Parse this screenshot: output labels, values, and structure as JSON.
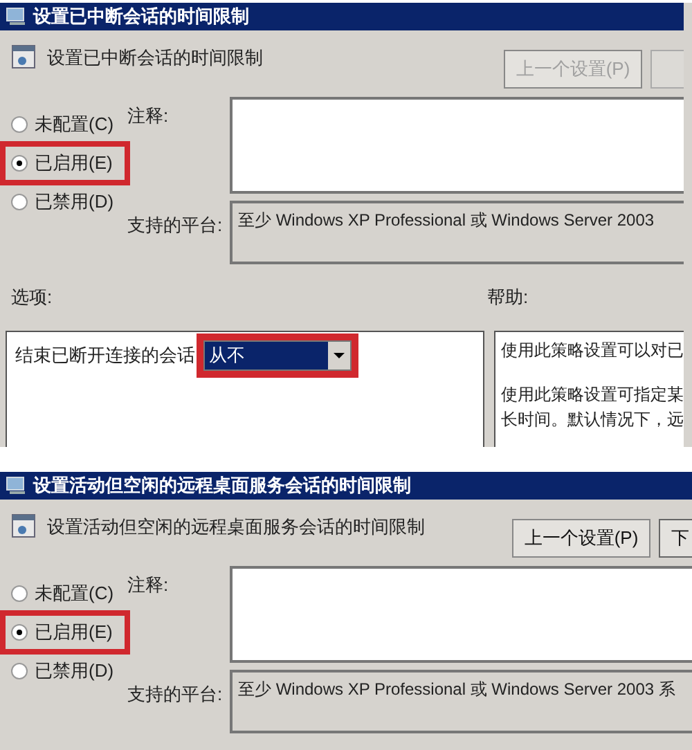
{
  "dialogs": [
    {
      "title": "设置已中断会话的时间限制",
      "heading": "设置已中断会话的时间限制",
      "prev_button": {
        "label": "上一个设置(P)",
        "disabled": true
      },
      "next_button": {
        "disabled": true
      },
      "states": [
        {
          "label": "未配置(C)",
          "selected": false,
          "highlighted": false
        },
        {
          "label": "已启用(E)",
          "selected": true,
          "highlighted": true
        },
        {
          "label": "已禁用(D)",
          "selected": false,
          "highlighted": false
        }
      ],
      "comment_label": "注释:",
      "platform_label": "支持的平台:",
      "platform": "至少 Windows XP Professional 或 Windows Server 2003",
      "options_label": "选项:",
      "help_label": "帮助:",
      "options": [
        {
          "label": "结束已断开连接的会话",
          "value": "从不",
          "highlighted": true
        }
      ],
      "help": [
        [
          "使用此策略设置可以对已"
        ],
        [
          "使用此策略设置可指定某",
          "长时间。默认情况下，远"
        ]
      ]
    },
    {
      "title": "设置活动但空闲的远程桌面服务会话的时间限制",
      "heading": "设置活动但空闲的远程桌面服务会话的时间限制",
      "prev_button": {
        "label": "上一个设置(P)",
        "disabled": false
      },
      "next_button": {
        "label": "下",
        "disabled": false
      },
      "states": [
        {
          "label": "未配置(C)",
          "selected": false,
          "highlighted": false
        },
        {
          "label": "已启用(E)",
          "selected": true,
          "highlighted": true
        },
        {
          "label": "已禁用(D)",
          "selected": false,
          "highlighted": false
        }
      ],
      "comment_label": "注释:",
      "platform_label": "支持的平台:",
      "platform": "至少 Windows XP Professional 或 Windows Server 2003 系"
    }
  ]
}
